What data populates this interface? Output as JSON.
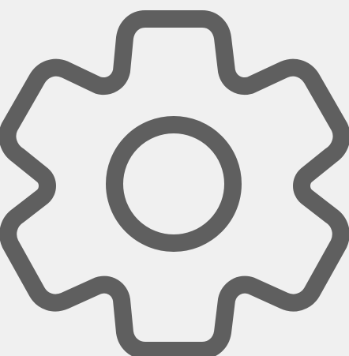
{
  "icon": {
    "name": "gear-icon",
    "stroke_color": "#5f5f5f",
    "background_color": "#f0f0f0"
  }
}
